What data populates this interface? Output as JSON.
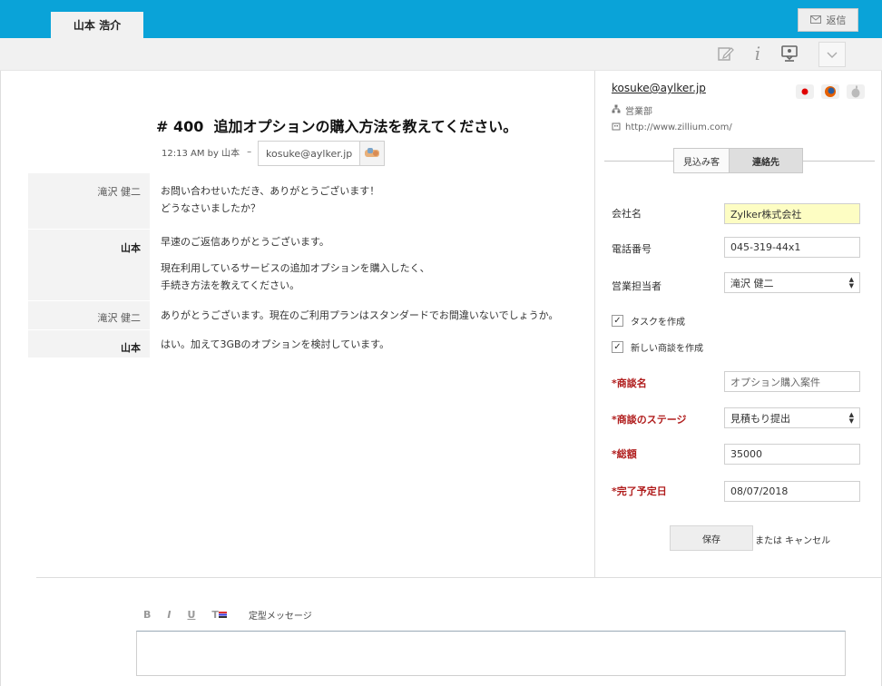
{
  "tab": {
    "label": "山本 浩介"
  },
  "reply_button": {
    "label": "返信"
  },
  "ticket": {
    "number": "# 400",
    "title": "追加オプションの購入方法を教えてください。",
    "meta": "12:13 AM by 山本",
    "meta_sep": "–",
    "email": "kosuke@aylker.jp"
  },
  "messages": [
    {
      "sender": "滝沢 健二",
      "lines": [
        "お問い合わせいただき、ありがとうございます！",
        "どうなさいましたか？"
      ]
    },
    {
      "sender": "山本",
      "lines": [
        "早速のご返信ありがとうございます。",
        "",
        "現在利用しているサービスの追加オプションを購入したく、",
        "手続き方法を教えてください。"
      ]
    },
    {
      "sender": "滝沢 健二",
      "lines": [
        "ありがとうございます。現在のご利用プランはスタンダードでお間違いないでしょうか。"
      ]
    },
    {
      "sender": "山本",
      "lines": [
        "はい。加えて3GBのオプションを検討しています。"
      ]
    }
  ],
  "contact": {
    "email": "kosuke@aylker.jp",
    "department": "営業部",
    "url": "http://www.zillium.com/"
  },
  "segments": {
    "prospect": "見込み客",
    "contact": "連絡先"
  },
  "form": {
    "company_label": "会社名",
    "company_value": "Zylker株式会社",
    "phone_label": "電話番号",
    "phone_value": "045-319-44x1",
    "owner_label": "営業担当者",
    "owner_value": "滝沢 健二",
    "task_label": "タスクを作成",
    "deal_label": "新しい商談を作成",
    "deal_name_label": "*商談名",
    "deal_name_placeholder": "オプション購入案件",
    "stage_label": "*商談のステージ",
    "stage_value": "見積もり提出",
    "amount_label": "*総額",
    "amount_value": "35000",
    "close_label": "*完了予定日",
    "close_value": "08/07/2018",
    "save_label": "保存",
    "or_cancel": "または キャンセル"
  },
  "editor": {
    "bold": "B",
    "italic": "I",
    "underline": "U",
    "text_color": "T",
    "template": "定型メッセージ"
  }
}
